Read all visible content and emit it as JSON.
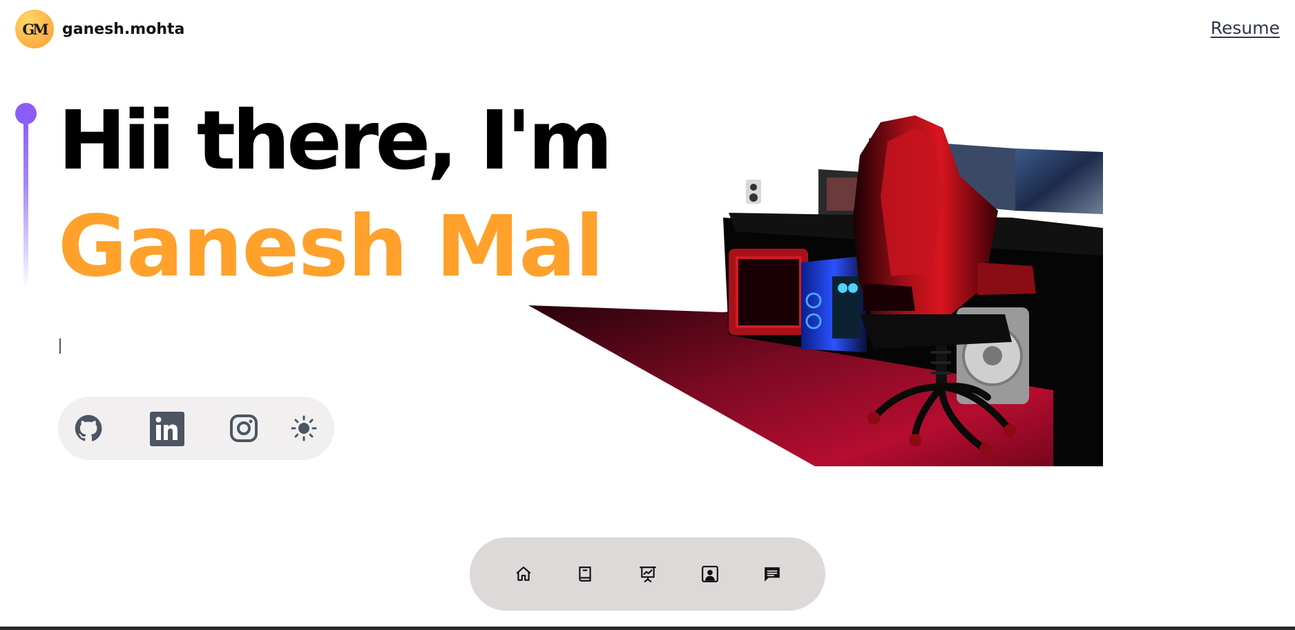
{
  "header": {
    "logo_text": "GM",
    "brand_name": "ganesh.mohta",
    "resume_label": "Resume"
  },
  "hero": {
    "greeting": "Hii there, I'm",
    "name": "Ganesh Mal",
    "typed_text": ""
  },
  "socials": [
    {
      "icon": "github-icon"
    },
    {
      "icon": "linkedin-icon"
    },
    {
      "icon": "instagram-icon"
    },
    {
      "icon": "sun-icon"
    }
  ],
  "dock": [
    {
      "icon": "home-icon"
    },
    {
      "icon": "book-icon"
    },
    {
      "icon": "presentation-icon"
    },
    {
      "icon": "contact-card-icon"
    },
    {
      "icon": "chat-icon"
    }
  ],
  "colors": {
    "accent_orange": "#ffa12b",
    "accent_purple": "#8b5cf6",
    "dock_bg": "#ddd9d8",
    "social_bg": "#f1eff0",
    "icon_gray": "#4b5563"
  }
}
